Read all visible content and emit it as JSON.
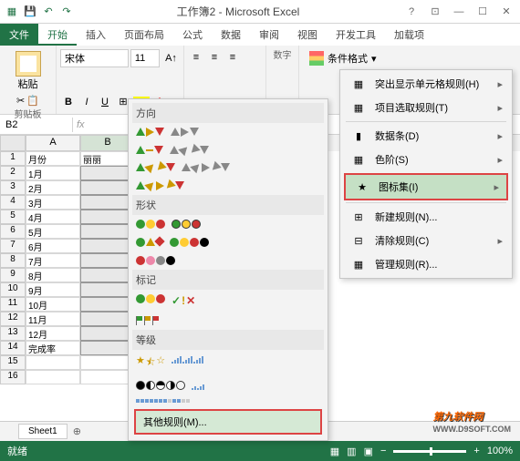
{
  "title": "工作簿2 - Microsoft Excel",
  "tabs": {
    "file": "文件",
    "home": "开始",
    "insert": "插入",
    "layout": "页面布局",
    "formula": "公式",
    "data": "数据",
    "review": "审阅",
    "view": "视图",
    "dev": "开发工具",
    "addin": "加载项"
  },
  "ribbon": {
    "paste": "粘贴",
    "clipboard": "剪贴板",
    "font": "宋体",
    "size": "11",
    "number": "数字",
    "cf": "条件格式"
  },
  "namebox": "B2",
  "colA": "A",
  "colB": "B",
  "rows": [
    {
      "n": "1",
      "a": "月份",
      "b": "丽丽"
    },
    {
      "n": "2",
      "a": "1月",
      "b": ""
    },
    {
      "n": "3",
      "a": "2月",
      "b": ""
    },
    {
      "n": "4",
      "a": "3月",
      "b": ""
    },
    {
      "n": "5",
      "a": "4月",
      "b": ""
    },
    {
      "n": "6",
      "a": "5月",
      "b": ""
    },
    {
      "n": "7",
      "a": "6月",
      "b": ""
    },
    {
      "n": "8",
      "a": "7月",
      "b": ""
    },
    {
      "n": "9",
      "a": "8月",
      "b": ""
    },
    {
      "n": "10",
      "a": "9月",
      "b": ""
    },
    {
      "n": "11",
      "a": "10月",
      "b": ""
    },
    {
      "n": "12",
      "a": "11月",
      "b": ""
    },
    {
      "n": "13",
      "a": "12月",
      "b": ""
    },
    {
      "n": "14",
      "a": "完成率",
      "b": ""
    },
    {
      "n": "15",
      "a": "",
      "b": ""
    },
    {
      "n": "16",
      "a": "",
      "b": ""
    }
  ],
  "sheet": "Sheet1",
  "status": {
    "ready": "就绪",
    "zoom": "100%"
  },
  "cf_menu": {
    "highlight": "突出显示单元格规则(H)",
    "top": "项目选取规则(T)",
    "databar": "数据条(D)",
    "colorscale": "色阶(S)",
    "iconset": "图标集(I)",
    "newrule": "新建规则(N)...",
    "clear": "清除规则(C)",
    "manage": "管理规则(R)..."
  },
  "picker": {
    "direction": "方向",
    "shape": "形状",
    "mark": "标记",
    "rank": "等级",
    "other": "其他规则(M)..."
  },
  "watermark": {
    "brand": "第九软件网",
    "url": "WWW.D9SOFT.COM"
  }
}
